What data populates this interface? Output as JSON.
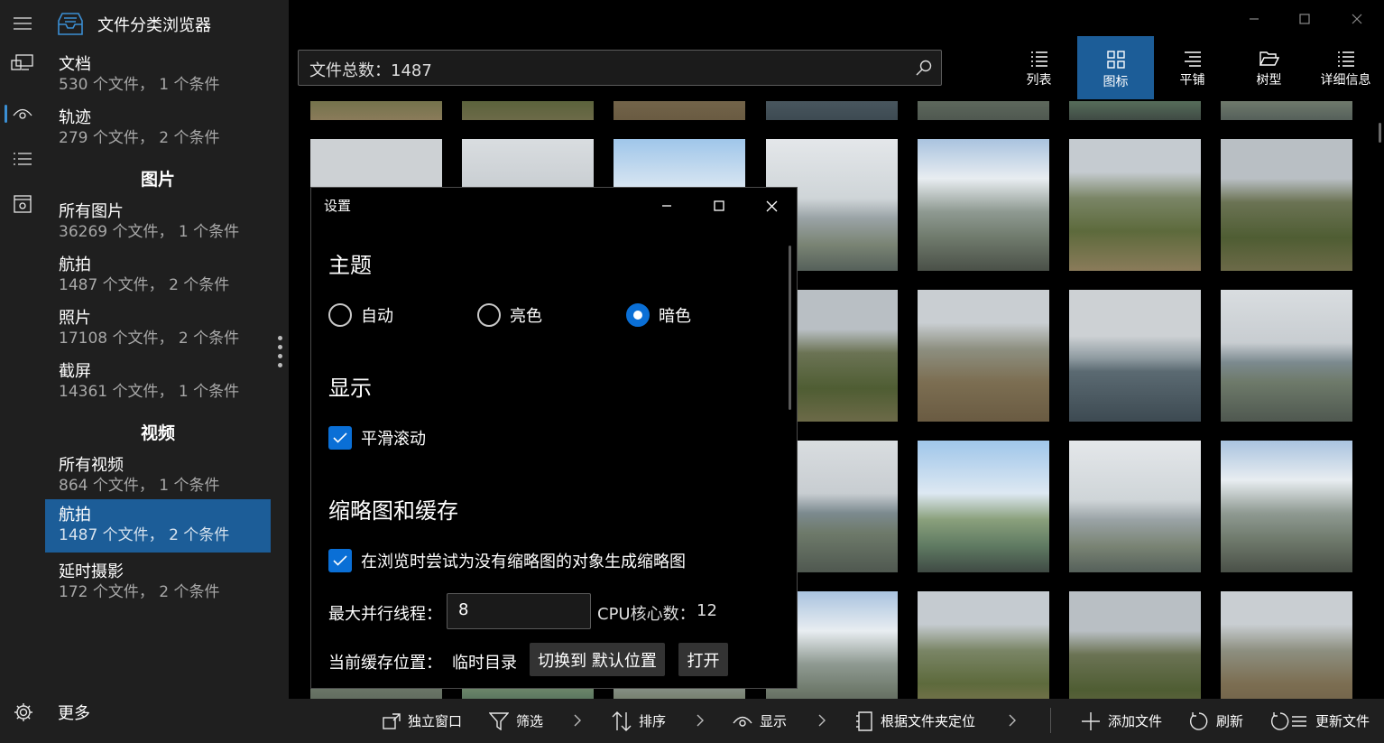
{
  "app": {
    "title": "文件分类浏览器"
  },
  "nav": {
    "groups": [
      {
        "title": "文档",
        "subtitle": "530 个文件， 1 个条件"
      },
      {
        "title": "轨迹",
        "subtitle": "279 个文件， 2 个条件"
      }
    ],
    "images_header": "图片",
    "images": [
      {
        "title": "所有图片",
        "subtitle": "36269 个文件， 1 个条件"
      },
      {
        "title": "航拍",
        "subtitle": "1487 个文件， 2 个条件"
      },
      {
        "title": "照片",
        "subtitle": "17108 个文件， 2 个条件"
      },
      {
        "title": "截屏",
        "subtitle": "14361 个文件， 1 个条件"
      }
    ],
    "videos_header": "视频",
    "videos": [
      {
        "title": "所有视频",
        "subtitle": "864 个文件， 1 个条件"
      },
      {
        "title": "航拍",
        "subtitle": "1487 个文件， 2 个条件",
        "selected": true
      },
      {
        "title": "延时摄影",
        "subtitle": "172 个文件， 2 个条件"
      }
    ],
    "more": "更多"
  },
  "search": {
    "value": "文件总数：1487"
  },
  "view_modes": [
    {
      "label": "列表",
      "icon": "list-icon"
    },
    {
      "label": "图标",
      "icon": "grid-icon",
      "active": true
    },
    {
      "label": "平铺",
      "icon": "tiles-icon"
    },
    {
      "label": "树型",
      "icon": "folder-open-icon"
    },
    {
      "label": "详细信息",
      "icon": "details-icon"
    }
  ],
  "settings": {
    "title": "设置",
    "theme_header": "主题",
    "theme_options": [
      "自动",
      "亮色",
      "暗色"
    ],
    "theme_selected": "暗色",
    "display_header": "显示",
    "smooth_scroll": "平滑滚动",
    "smooth_scroll_checked": true,
    "thumb_header": "缩略图和缓存",
    "gen_thumbs": "在浏览时尝试为没有缩略图的对象生成缩略图",
    "gen_thumbs_checked": true,
    "max_threads_label": "最大并行线程：",
    "max_threads_value": "8",
    "cpu_cores_label": "CPU核心数：",
    "cpu_cores_value": "12",
    "cache_label": "当前缓存位置：",
    "cache_value": "临时目录",
    "switch_button": "切换到 默认位置",
    "open_button": "打开"
  },
  "bottom_bar": {
    "standalone": "独立窗口",
    "filter": "筛选",
    "sort": "排序",
    "display": "显示",
    "locate": "根据文件夹定位",
    "add_files": "添加文件",
    "refresh": "刷新",
    "update_files": "更新文件"
  },
  "colors": {
    "accent": "#1c5d98",
    "checkbox": "#0a6fd6",
    "pane": "#1f1f1f"
  }
}
